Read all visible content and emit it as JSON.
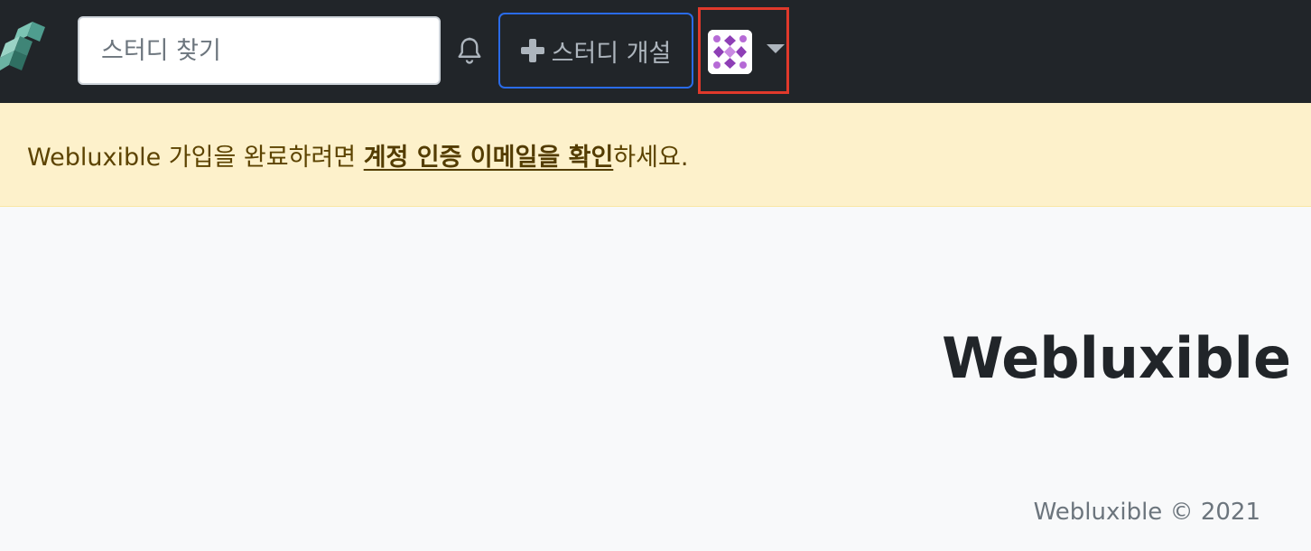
{
  "navbar": {
    "logo_icon": "brand-logo-icon",
    "search": {
      "placeholder": "스터디 찾기",
      "value": ""
    },
    "notification_icon": "bell-icon",
    "create_study": {
      "icon": "plus-icon",
      "label": "스터디 개설"
    },
    "profile": {
      "avatar_icon": "identicon-avatar",
      "caret_icon": "caret-down-icon"
    },
    "colors": {
      "background": "#212529",
      "accent": "#2a6be8",
      "highlight": "#e0392b"
    }
  },
  "alert": {
    "prefix": "Webluxible 가입을 완료하려면 ",
    "link": "계정 인증 이메일을 확인",
    "suffix": "하세요."
  },
  "main": {
    "title": "Webluxible"
  },
  "footer": {
    "text": "Webluxible © 2021"
  }
}
